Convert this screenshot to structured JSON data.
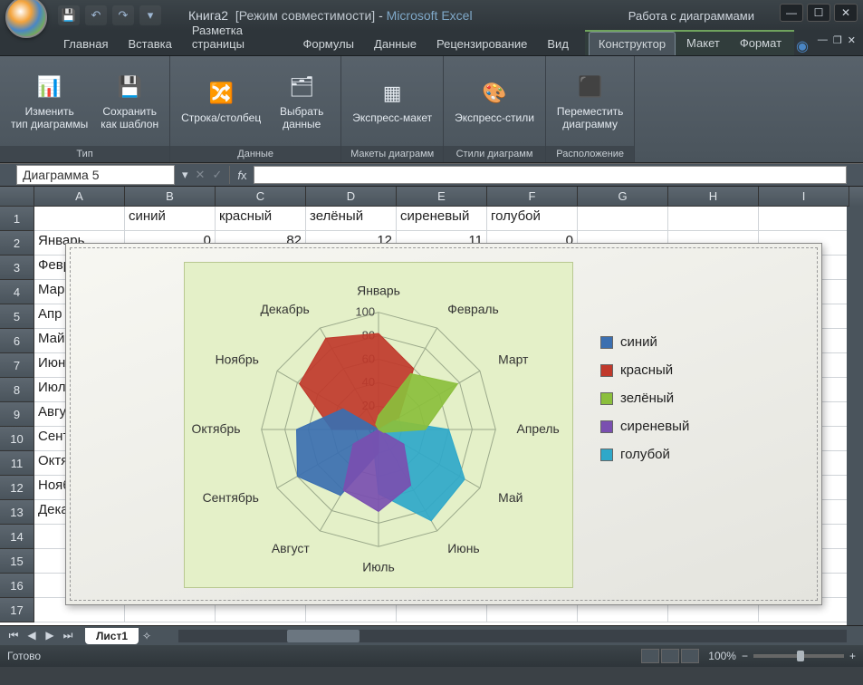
{
  "titlebar": {
    "doc": "Книга2",
    "compat": "[Режим совместимости]",
    "app": "Microsoft Excel",
    "context_title": "Работа с диаграммами"
  },
  "tabs": {
    "items": [
      "Главная",
      "Вставка",
      "Разметка страницы",
      "Формулы",
      "Данные",
      "Рецензирование",
      "Вид"
    ],
    "context": [
      "Конструктор",
      "Макет",
      "Формат"
    ],
    "active": "Конструктор"
  },
  "ribbon": {
    "groups": [
      {
        "label": "Тип",
        "buttons": [
          {
            "id": "change-type",
            "label": "Изменить тип диаграммы",
            "icon": "📊"
          },
          {
            "id": "save-template",
            "label": "Сохранить как шаблон",
            "icon": "💾"
          }
        ]
      },
      {
        "label": "Данные",
        "buttons": [
          {
            "id": "switch-rowcol",
            "label": "Строка/столбец",
            "icon": "🔀"
          },
          {
            "id": "select-data",
            "label": "Выбрать данные",
            "icon": "🗂"
          }
        ]
      },
      {
        "label": "Макеты диаграмм",
        "buttons": [
          {
            "id": "quick-layout",
            "label": "Экспресс-макет",
            "icon": "▦"
          }
        ]
      },
      {
        "label": "Стили диаграмм",
        "buttons": [
          {
            "id": "quick-style",
            "label": "Экспресс-стили",
            "icon": "🎨"
          }
        ]
      },
      {
        "label": "Расположение",
        "buttons": [
          {
            "id": "move-chart",
            "label": "Переместить диаграмму",
            "icon": "⬛"
          }
        ]
      }
    ]
  },
  "namebox": "Диаграмма 5",
  "columns": [
    "A",
    "B",
    "C",
    "D",
    "E",
    "F",
    "G",
    "H",
    "I"
  ],
  "grid": {
    "header_row": [
      "",
      "синий",
      "красный",
      "зелёный",
      "сиреневый",
      "голубой"
    ],
    "data_row": [
      "Январь",
      "0",
      "82",
      "12",
      "11",
      "0"
    ],
    "months_col": [
      "Февр",
      "Мар",
      "Апр",
      "Май",
      "Июн",
      "Июл",
      "Авгу",
      "Сент",
      "Октя",
      "Нояб",
      "Дека"
    ]
  },
  "legend": [
    {
      "name": "синий",
      "color": "#3b6fb0"
    },
    {
      "name": "красный",
      "color": "#c0392b"
    },
    {
      "name": "зелёный",
      "color": "#8bbf3c"
    },
    {
      "name": "сиреневый",
      "color": "#7a4fb0"
    },
    {
      "name": "голубой",
      "color": "#2fa8c9"
    }
  ],
  "chart_data": {
    "type": "radar",
    "categories": [
      "Январь",
      "Февраль",
      "Март",
      "Апрель",
      "Май",
      "Июнь",
      "Июль",
      "Август",
      "Сентябрь",
      "Октябрь",
      "Ноябрь",
      "Декабрь"
    ],
    "ticks": [
      0,
      20,
      40,
      60,
      80,
      100
    ],
    "ylim": [
      0,
      100
    ],
    "series": [
      {
        "name": "синий",
        "color": "#3b6fb0",
        "values": [
          0,
          0,
          0,
          0,
          0,
          0,
          20,
          65,
          80,
          70,
          35,
          0
        ]
      },
      {
        "name": "красный",
        "color": "#c0392b",
        "values": [
          82,
          60,
          20,
          0,
          0,
          0,
          0,
          0,
          0,
          40,
          78,
          90
        ]
      },
      {
        "name": "зелёный",
        "color": "#8bbf3c",
        "values": [
          12,
          55,
          78,
          40,
          5,
          0,
          0,
          0,
          0,
          0,
          0,
          5
        ]
      },
      {
        "name": "сиреневый",
        "color": "#7a4fb0",
        "values": [
          11,
          0,
          0,
          0,
          25,
          55,
          70,
          60,
          25,
          0,
          0,
          0
        ]
      },
      {
        "name": "голубой",
        "color": "#2fa8c9",
        "values": [
          0,
          0,
          15,
          60,
          85,
          90,
          55,
          10,
          0,
          0,
          0,
          0
        ]
      }
    ]
  },
  "sheet": {
    "active": "Лист1"
  },
  "status": {
    "ready": "Готово",
    "zoom": "100%"
  }
}
